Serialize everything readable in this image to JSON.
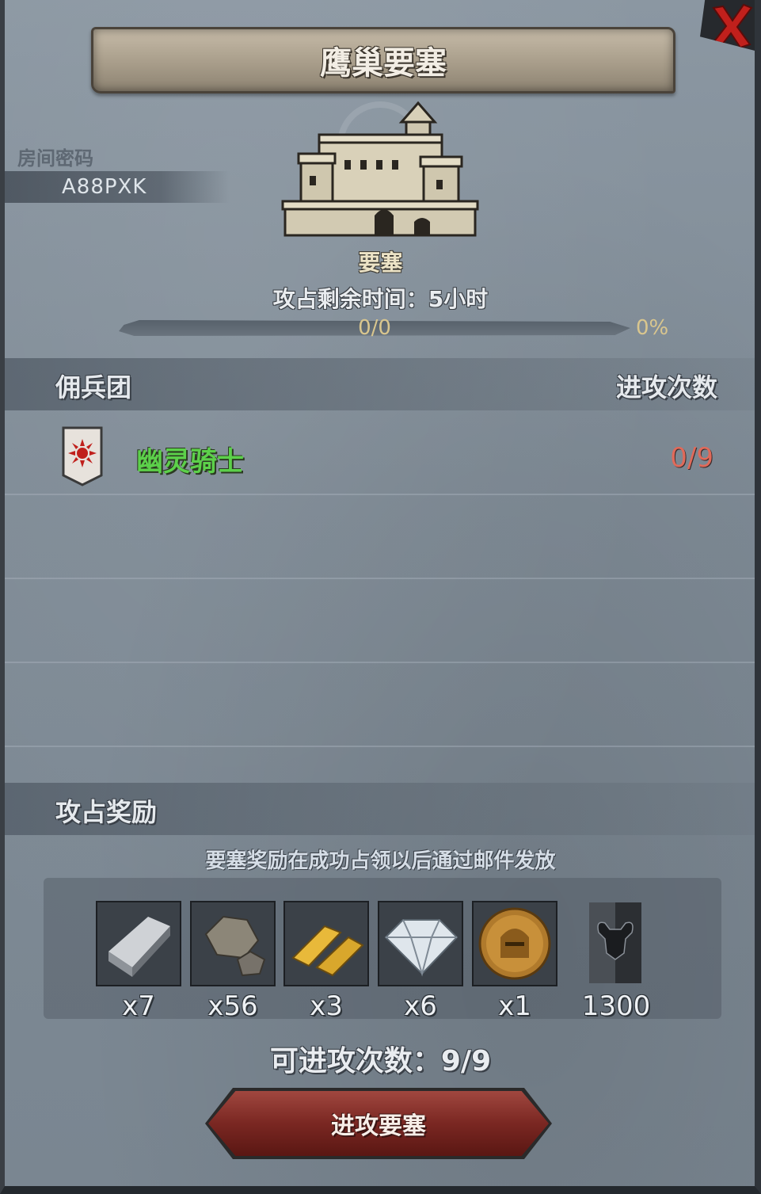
{
  "header": {
    "title": "鹰巢要塞",
    "close_icon": "close-x-icon"
  },
  "room": {
    "label": "房间密码",
    "code": "A88PXK"
  },
  "fortress": {
    "icon": "castle-icon",
    "name": "要塞",
    "time_remaining": "攻占剩余时间：5小时",
    "progress_text": "0/0",
    "progress_percent": "0%",
    "progress_fraction": 0
  },
  "mercenaries": {
    "header_left": "佣兵团",
    "header_right": "进攻次数",
    "rows": [
      {
        "shield_icon": "red-sun-banner-icon",
        "name": "幽灵骑士",
        "attacks": "0/9"
      }
    ]
  },
  "rewards": {
    "header": "攻占奖励",
    "note": "要塞奖励在成功占领以后通过邮件发放",
    "items": [
      {
        "icon": "iron-ingot-icon",
        "qty": "x7"
      },
      {
        "icon": "stone-icon",
        "qty": "x56"
      },
      {
        "icon": "gold-bars-icon",
        "qty": "x3"
      },
      {
        "icon": "diamond-icon",
        "qty": "x6"
      },
      {
        "icon": "knight-coin-icon",
        "qty": "x1"
      },
      {
        "icon": "bull-banner-icon",
        "qty": "1300"
      }
    ]
  },
  "attacks_left": "可进攻次数：9/9",
  "attack_button": {
    "label": "进攻要塞"
  },
  "colors": {
    "green_name": "#5cd04a",
    "red_count": "#e06a5a",
    "gold_progress": "#d9c68e",
    "button_red": "#7a2722"
  }
}
